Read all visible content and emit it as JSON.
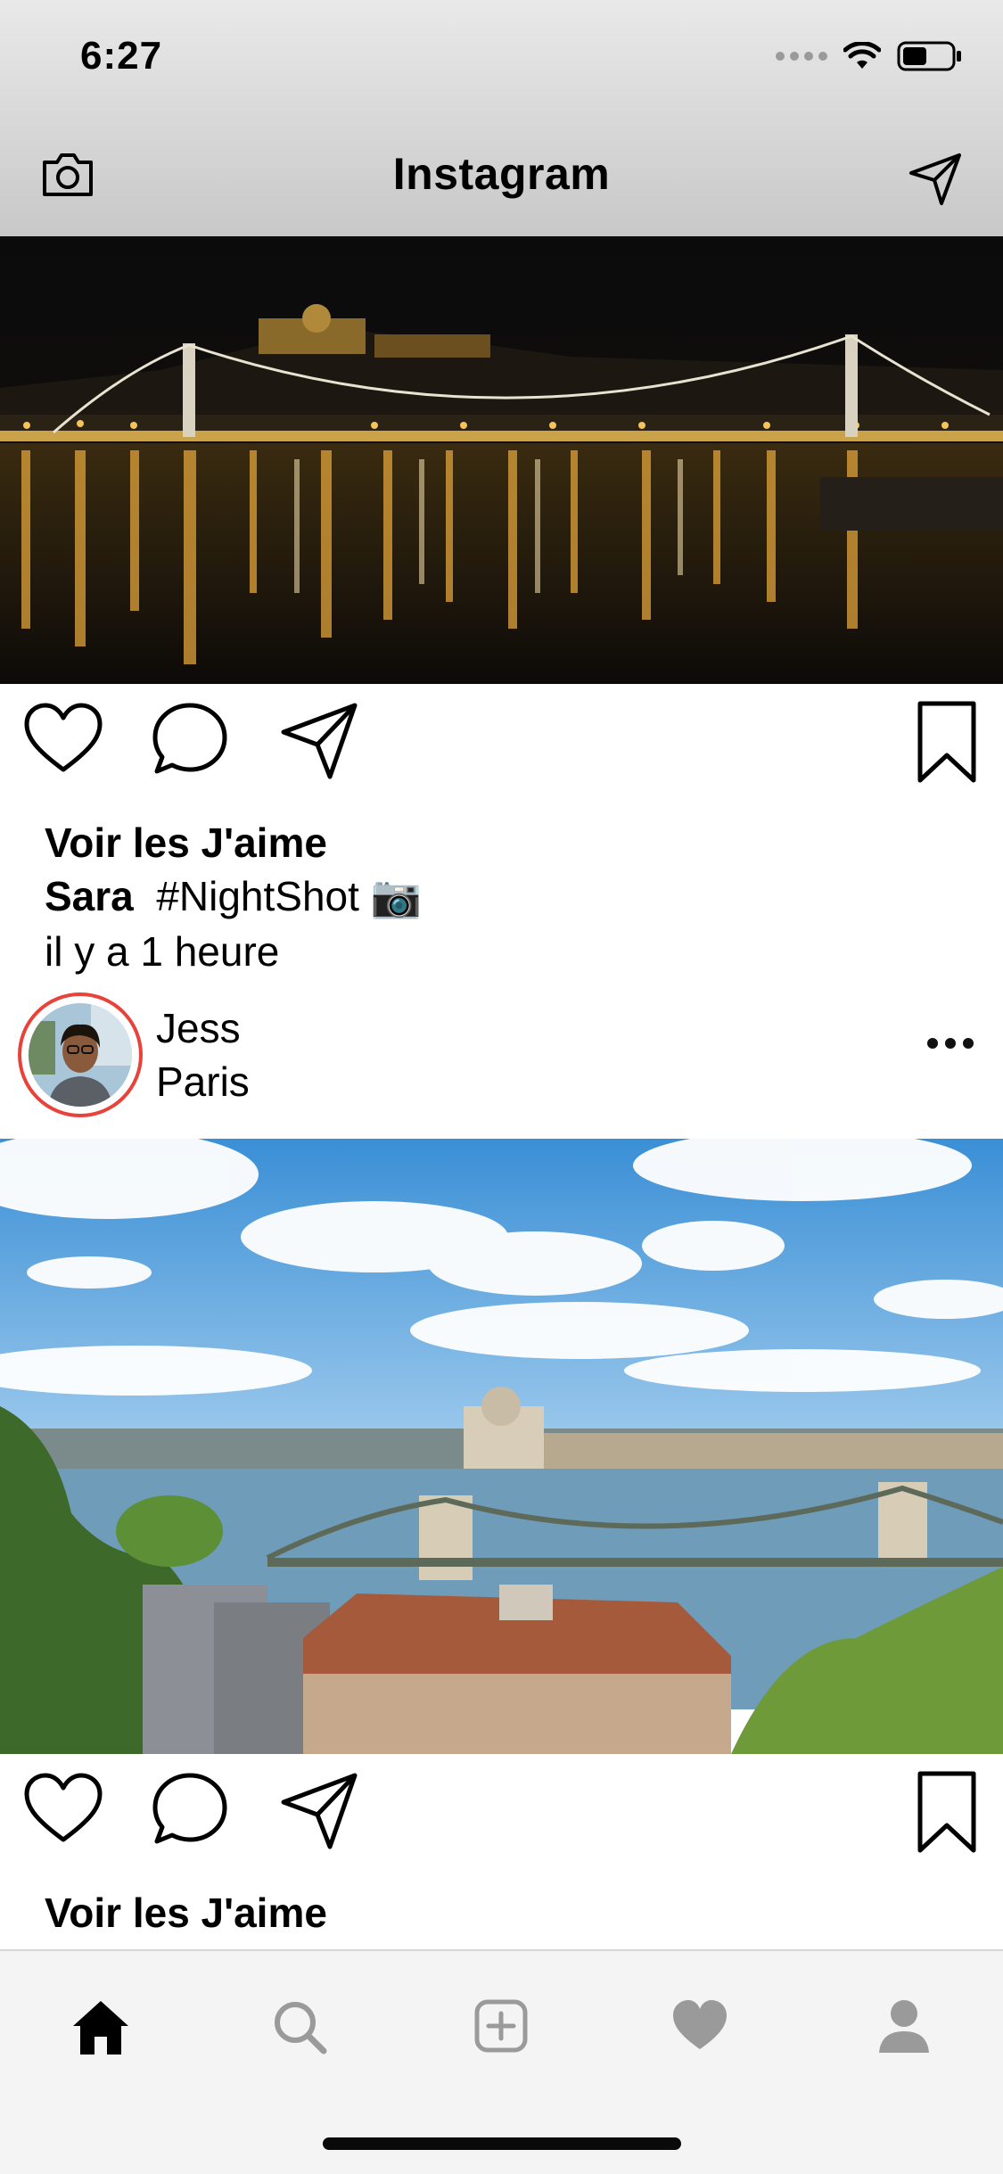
{
  "status_bar": {
    "time": "6:27"
  },
  "header": {
    "title": "Instagram",
    "camera_icon": "camera-icon",
    "direct_icon": "paper-plane-icon"
  },
  "posts": [
    {
      "image": "budapest-night-bridge-photo",
      "likes_label": "Voir les J'aime",
      "caption_user": "Sara",
      "caption_text": "#NightShot 📷",
      "time_ago": "il y a 1 heure"
    },
    {
      "user": "Jess",
      "location": "Paris",
      "image": "budapest-day-chain-bridge-photo",
      "likes_label": "Voir les J'aime"
    }
  ],
  "tabbar": {
    "items": [
      "home-icon",
      "search-icon",
      "add-icon",
      "heart-icon",
      "profile-icon"
    ],
    "active": "home-icon"
  },
  "colors": {
    "story_ring": "#e8433b",
    "header_bg": "#d9d9d9",
    "tab_inactive": "#9a9a9a"
  }
}
